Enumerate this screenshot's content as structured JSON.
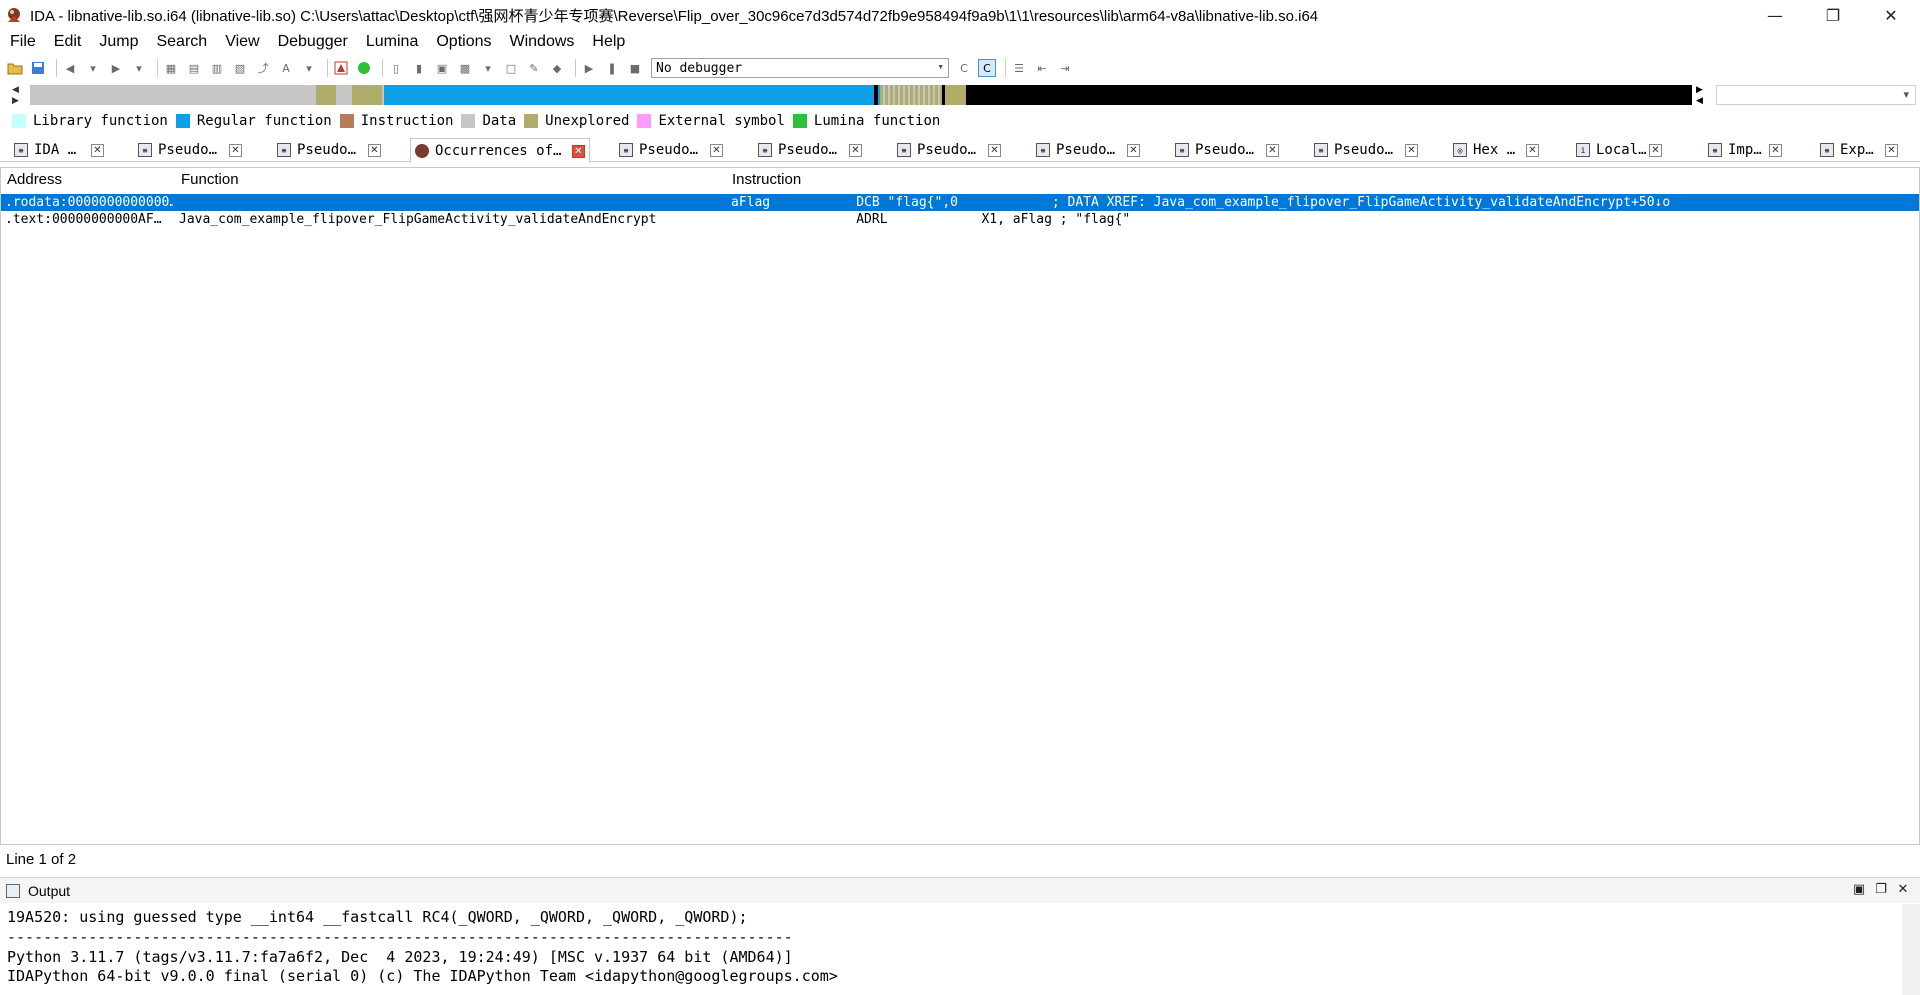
{
  "titlebar": {
    "title": "IDA - libnative-lib.so.i64 (libnative-lib.so) C:\\Users\\attac\\Desktop\\ctf\\强网杯青少年专项赛\\Reverse\\Flip_over_30c96ce7d3d574d72fb9e958494f9a9b\\1\\1\\resources\\lib\\arm64-v8a\\libnative-lib.so.i64",
    "minimize": "—",
    "restore": "❐",
    "close": "✕"
  },
  "menu": [
    "File",
    "Edit",
    "Jump",
    "Search",
    "View",
    "Debugger",
    "Lumina",
    "Options",
    "Windows",
    "Help"
  ],
  "toolbar": {
    "debugger": "No debugger"
  },
  "legend": [
    {
      "label": "Library function",
      "color": "#c6ffff"
    },
    {
      "label": "Regular function",
      "color": "#0ea0e6"
    },
    {
      "label": "Instruction",
      "color": "#b87c5a"
    },
    {
      "label": "Data",
      "color": "#c6c6c6"
    },
    {
      "label": "Unexplored",
      "color": "#b0ad6a"
    },
    {
      "label": "External symbol",
      "color": "#ff99ff"
    },
    {
      "label": "Lumina function",
      "color": "#2fbf3a"
    }
  ],
  "tabs": [
    {
      "label": "IDA …",
      "icon": "disassembly-icon"
    },
    {
      "label": "Pseudo…",
      "icon": "pseudocode-icon"
    },
    {
      "label": "Pseudo…",
      "icon": "pseudocode-icon"
    },
    {
      "label": "Occurrences of…",
      "icon": "ida-logo-icon",
      "active": true
    },
    {
      "label": "Pseudo…",
      "icon": "pseudocode-icon"
    },
    {
      "label": "Pseudo…",
      "icon": "pseudocode-icon"
    },
    {
      "label": "Pseudo…",
      "icon": "pseudocode-icon"
    },
    {
      "label": "Pseudo…",
      "icon": "pseudocode-icon"
    },
    {
      "label": "Pseudo…",
      "icon": "pseudocode-icon"
    },
    {
      "label": "Pseudo…",
      "icon": "pseudocode-icon"
    },
    {
      "label": "Hex …",
      "icon": "hex-view-icon"
    },
    {
      "label": "Local…",
      "icon": "local-types-icon"
    },
    {
      "label": "Imp…",
      "icon": "imports-icon"
    },
    {
      "label": "Exp…",
      "icon": "exports-icon"
    }
  ],
  "grid": {
    "columns": [
      "Address",
      "Function",
      "Instruction"
    ],
    "rows": [
      {
        "address": ".rodata:0000000000000…",
        "function": "",
        "instruction": "aFlag           DCB \"flag{\",0            ; DATA XREF: Java_com_example_flipover_FlipGameActivity_validateAndEncrypt+50↓o",
        "selected": true
      },
      {
        "address": ".text:00000000000AF…",
        "function": "Java_com_example_flipover_FlipGameActivity_validateAndEncrypt",
        "instruction": "                ADRL            X1, aFlag ; \"flag{\"",
        "selected": false
      }
    ]
  },
  "status": "Line 1 of 2",
  "output": {
    "title": "Output",
    "lines": [
      "19A520: using guessed type __int64 __fastcall RC4(_QWORD, _QWORD, _QWORD, _QWORD);",
      "---------------------------------------------------------------------------------------",
      "Python 3.11.7 (tags/v3.11.7:fa7a6f2, Dec  4 2023, 19:24:49) [MSC v.1937 64 bit (AMD64)]",
      "IDAPython 64-bit v9.0.0 final (serial 0) (c) The IDAPython Team <idapython@googlegroups.com>"
    ]
  }
}
